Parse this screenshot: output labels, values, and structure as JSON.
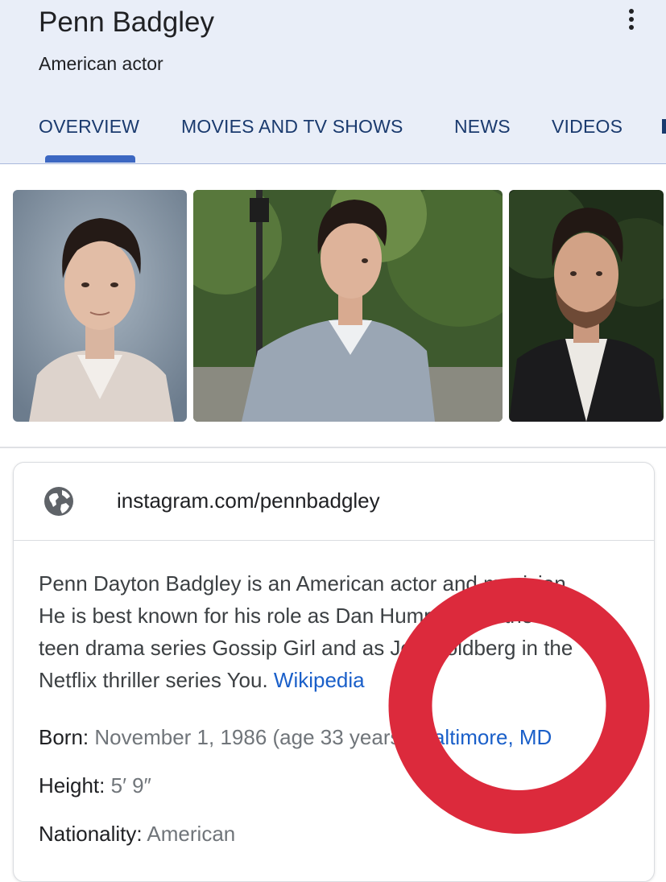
{
  "header": {
    "title": "Penn Badgley",
    "subtitle": "American actor",
    "more_icon": "more-vert-icon"
  },
  "tabs": [
    {
      "label": "OVERVIEW",
      "active": true
    },
    {
      "label": "MOVIES AND TV SHOWS",
      "active": false
    },
    {
      "label": "NEWS",
      "active": false
    },
    {
      "label": "VIDEOS",
      "active": false
    }
  ],
  "card": {
    "link_icon": "globe-icon",
    "link_text": "instagram.com/pennbadgley",
    "description": "Penn Dayton Badgley is an American actor and musician. He is best known for his role as Dan Humphrey in the CW teen drama series Gossip Girl and as Joe Goldberg in the Netflix thriller series You.",
    "description_lines": [
      "Penn Dayton Badgley is an American actor and musician.",
      "He is best known for his role as Dan Humphrey in the CW",
      "teen drama series Gossip Girl and as Joe Goldberg in the",
      "Netflix thriller series You."
    ],
    "source_link": "Wikipedia",
    "facts": {
      "born_label": "Born:",
      "born_value": "November 1, 1986 (age 33 years),",
      "born_place": "Baltimore, MD",
      "height_label": "Height:",
      "height_value": "5′ 9″",
      "nationality_label": "Nationality:",
      "nationality_value": "American"
    }
  },
  "colors": {
    "header_bg": "#e9eef8",
    "tab_text": "#1a3a6e",
    "tab_indicator": "#3c67c2",
    "link_blue": "#1a5fc9",
    "annotation_red": "#dc2a3c"
  }
}
